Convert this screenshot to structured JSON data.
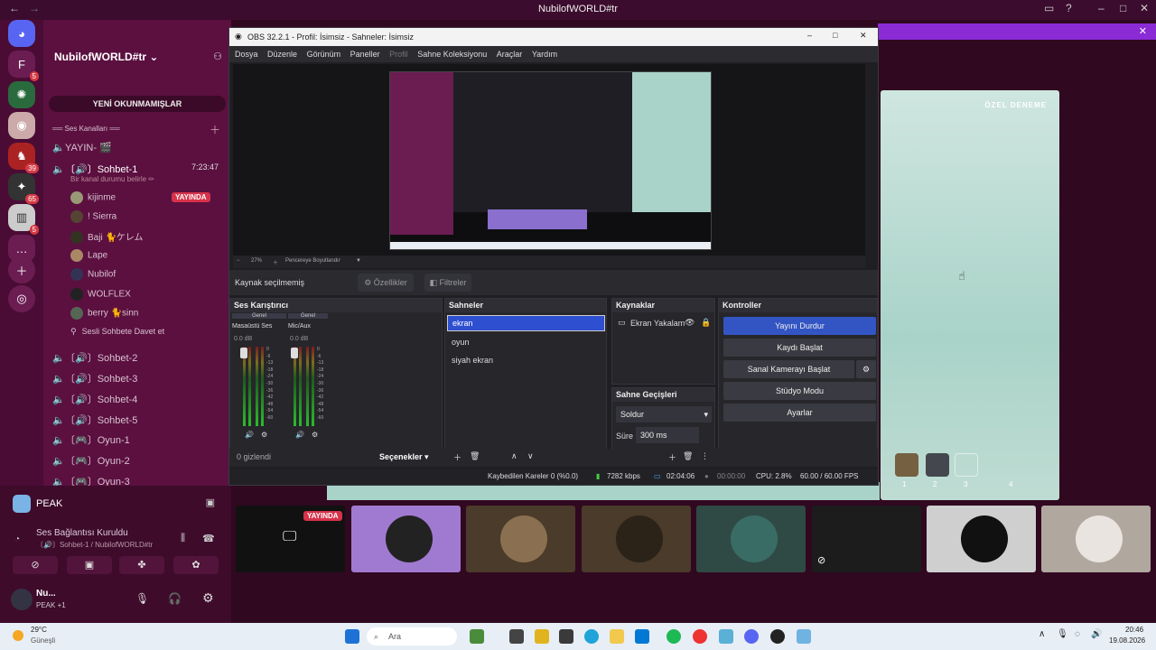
{
  "window_title": "NubilofWORLD#tr",
  "discord": {
    "server_name": "NubilofWORLD#tr",
    "unread_label": "YENİ OKUNMAMIŞLAR",
    "category_label": "══ Ses Kanalları ══",
    "channel_yayin": "YAYIN- 🎬",
    "active_channel": "〔🔊〕Sohbet-1",
    "active_channel_time": "7:23:47",
    "channel_status": "Bir kanal durumu belirle ✏",
    "live_badge": "YAYINDA",
    "users": [
      "kijinme",
      "! Sierra",
      "Baji 🐈ケレム",
      "Lape",
      "Nubilof",
      "WOLFLEX",
      "berry 🐈sinn"
    ],
    "invite_label": "Sesli Sohbete Davet et",
    "channels": [
      "〔🔊〕Sohbet-2",
      "〔🔊〕Sohbet-3",
      "〔🔊〕Sohbet-4",
      "〔🔊〕Sohbet-5",
      "〔🎮〕Oyun-1",
      "〔🎮〕Oyun-2",
      "〔🎮〕Oyun-3"
    ],
    "server_badges": [
      "5",
      "39",
      "65",
      "5"
    ],
    "activity_name": "PEAK",
    "voice_status": "Ses Bağlantısı Kuruldu",
    "voice_channel": "〔🔊〕Sohbet-1 / NubilofWORLD#tr",
    "self_name": "Nu...",
    "self_activity": "PEAK +1"
  },
  "obs": {
    "title": "OBS 32.2.1 - Profil: İsimsiz - Sahneler: İsimsiz",
    "menu": [
      "Dosya",
      "Düzenle",
      "Görünüm",
      "Paneller",
      "Profil",
      "Sahne Koleksiyonu",
      "Araçlar",
      "Yardım"
    ],
    "zoom": "27%",
    "fit_label": "Pencereye Boyutlandır",
    "no_source": "Kaynak seçilmemiş",
    "properties": "Özellikler",
    "filters": "Filtreler",
    "mixer_title": "Ses Karıştırıcı",
    "mixer_channels": [
      {
        "tag": "Genel",
        "name": "Masaüstü Ses",
        "db": "0.0 dB"
      },
      {
        "tag": "Genel",
        "name": "Mic/Aux",
        "db": "0.0 dB"
      }
    ],
    "meter_ticks": [
      "0",
      "-6",
      "-13",
      "-18",
      "-24",
      "-30",
      "-36",
      "-42",
      "-48",
      "-54",
      "-60"
    ],
    "hidden_label": "0 gizlendi",
    "options_label": "Seçenekler",
    "scenes_title": "Sahneler",
    "scenes": [
      "ekran",
      "oyun",
      "siyah ekran"
    ],
    "sources_title": "Kaynaklar",
    "source_item": "Ekran Yakalam",
    "transitions_title": "Sahne Geçişleri",
    "transition": "Soldur",
    "duration_label": "Süre",
    "duration_value": "300 ms",
    "controls_title": "Kontroller",
    "controls": [
      "Yayını Durdur",
      "Kaydı Başlat",
      "Sanal Kamerayı Başlat",
      "Stüdyo Modu",
      "Ayarlar"
    ],
    "status": {
      "dropped": "Kaybedilen Kareler 0 (%0.0)",
      "kbps": "7282 kbps",
      "live_time": "02:04:06",
      "rec_time": "00:00:00",
      "cpu": "CPU: 2.8%",
      "fps": "60.00 / 60.00 FPS"
    }
  },
  "game": {
    "overlay_title": "ÖZEL DENEME",
    "slots": [
      "1",
      "2",
      "3",
      "4"
    ]
  },
  "stream_badge": "YAYINDA",
  "taskbar": {
    "weather_temp": "29°C",
    "weather_desc": "Güneşli",
    "search": "Ara",
    "time": "20:46",
    "date": "19.08.2026"
  }
}
